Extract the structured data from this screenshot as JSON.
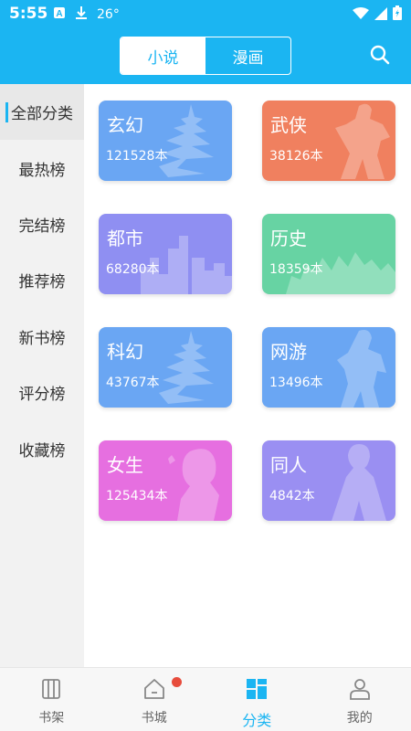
{
  "status_bar": {
    "time": "5:55",
    "temp": "26°"
  },
  "header": {
    "tabs": [
      {
        "label": "小说",
        "active": true
      },
      {
        "label": "漫画",
        "active": false
      }
    ],
    "search_icon": "search-icon",
    "accent_color": "#1bb5f2"
  },
  "sidebar": {
    "items": [
      {
        "label": "全部分类",
        "active": true
      },
      {
        "label": "最热榜"
      },
      {
        "label": "完结榜"
      },
      {
        "label": "推荐榜"
      },
      {
        "label": "新书榜"
      },
      {
        "label": "评分榜"
      },
      {
        "label": "收藏榜"
      }
    ]
  },
  "categories": [
    {
      "name": "玄幻",
      "count": "121528本",
      "color": "#6aa6f3"
    },
    {
      "name": "武侠",
      "count": "38126本",
      "color": "#f0805f"
    },
    {
      "name": "都市",
      "count": "68280本",
      "color": "#8f8ff2"
    },
    {
      "name": "历史",
      "count": "18359本",
      "color": "#67d3a3"
    },
    {
      "name": "科幻",
      "count": "43767本",
      "color": "#6aa6f3"
    },
    {
      "name": "网游",
      "count": "13496本",
      "color": "#6aa6f3"
    },
    {
      "name": "女生",
      "count": "125434本",
      "color": "#e66fe0"
    },
    {
      "name": "同人",
      "count": "4842本",
      "color": "#9a8ff2"
    }
  ],
  "bottom_nav": [
    {
      "label": "书架",
      "icon": "bookshelf-icon"
    },
    {
      "label": "书城",
      "icon": "home-icon",
      "badge": true
    },
    {
      "label": "分类",
      "icon": "category-icon",
      "active": true
    },
    {
      "label": "我的",
      "icon": "profile-icon"
    }
  ]
}
